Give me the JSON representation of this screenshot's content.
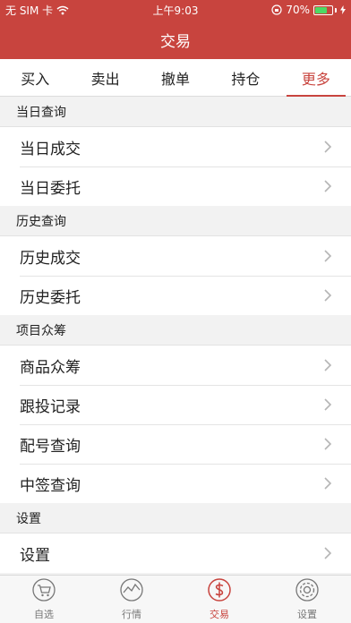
{
  "status": {
    "carrier": "无 SIM 卡",
    "time": "上午9:03",
    "battery": "70%",
    "battery_level": 0.7
  },
  "navbar": {
    "title": "交易"
  },
  "tabs": [
    {
      "label": "买入",
      "active": false
    },
    {
      "label": "卖出",
      "active": false
    },
    {
      "label": "撤单",
      "active": false
    },
    {
      "label": "持仓",
      "active": false
    },
    {
      "label": "更多",
      "active": true
    }
  ],
  "sections": [
    {
      "title": "当日查询",
      "items": [
        "当日成交",
        "当日委托"
      ]
    },
    {
      "title": "历史查询",
      "items": [
        "历史成交",
        "历史委托"
      ]
    },
    {
      "title": "项目众筹",
      "items": [
        "商品众筹",
        "跟投记录",
        "配号查询",
        "中签查询"
      ]
    },
    {
      "title": "设置",
      "items": [
        "设置"
      ]
    }
  ],
  "bottom_nav": [
    {
      "label": "自选",
      "icon": "cart-icon",
      "active": false
    },
    {
      "label": "行情",
      "icon": "chart-icon",
      "active": false
    },
    {
      "label": "交易",
      "icon": "dollar-icon",
      "active": true
    },
    {
      "label": "设置",
      "icon": "gear-icon",
      "active": false
    }
  ],
  "colors": {
    "brand": "#c8443e",
    "battery": "#4cd964"
  }
}
